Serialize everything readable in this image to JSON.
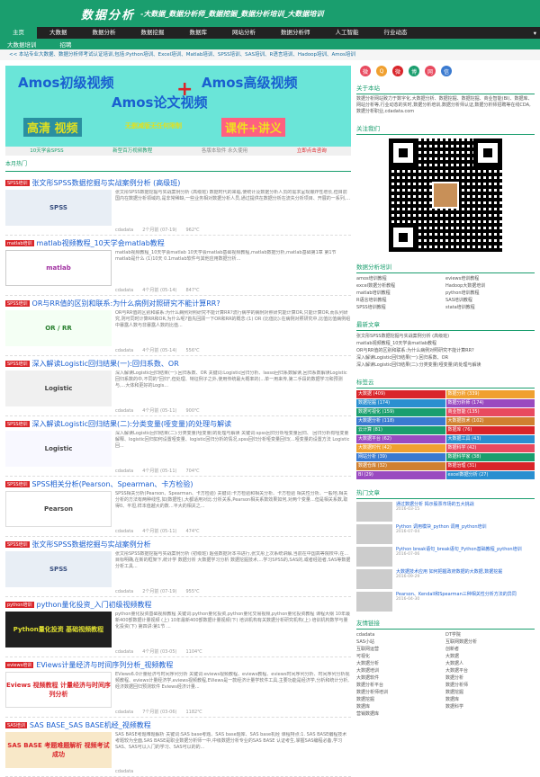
{
  "header": {
    "logo": "数据分析",
    "slogan": "-大数据_数据分析师_数据挖掘_数据分析培训_大数据培训"
  },
  "nav": {
    "items": [
      "主页",
      "大数据",
      "数据分析",
      "数据挖掘",
      "数据库",
      "网站分析",
      "数据分析师",
      "人工智能",
      "行业动态"
    ]
  },
  "subnav": {
    "items": [
      "大数据培训",
      "招聘"
    ]
  },
  "ticker": "<< 本站专业大数据、数据分析师考试认证培训,包括:Python培训、Excel培训、Matlab培训、SPSS培训、SAS培训、R语言培训、Hadoop培训、Amos培训",
  "banner": {
    "t1": "Amos初级视频",
    "t2": "Amos高级视频",
    "plus": "+",
    "t3": "Amos论文视频",
    "t4": "高清 视频",
    "t5": "无删减版无任何限制",
    "t6": "课件+讲义",
    "links": [
      "10天学会SPSS",
      "新型百万视频教程",
      "各版本软件 永久使用",
      "立即点击咨询"
    ]
  },
  "hot_label": "本月热门",
  "articles": [
    {
      "tag": "SPSS培训",
      "title": "张文彤SPSS数据挖掘与实战案例分析 (高级班)",
      "thumb": "SPSS",
      "excerpt": "张文彤SPSS数据挖掘与实战案例分析 (高级班) 数据时代的来临,使统计及数据分析人员的需求呈现爆炸性增长,但目前国内在数据分析领域的,是非常稀缺,一些业务相对数据分析人员,通过提供在数据分析在流失分析项目、开展的一系列,...",
      "meta": [
        "cdadata",
        "2个月前 (07-19)",
        "962℃"
      ],
      "thumb_class": "th-spss"
    },
    {
      "tag": "matlab培训",
      "title": "matlab视频教程_10天学会matlab教程",
      "thumb": "matlab",
      "excerpt": "matlab视频教程_10天学会matlab 10天学会matlab基础视频教程,matlab数据分析,matlab基础第1章 第1节matlab是什么 (1)10天 0.1matlab软件与其他应用数据分析...",
      "meta": [
        "cdadata",
        "4个月前 (05-14)",
        "847℃"
      ],
      "thumb_class": "th-matlab"
    },
    {
      "tag": "SPSS培训",
      "title": "OR与RR值的区别和联系:为什么病例对照研究不能计算RR?",
      "thumb": "OR / RR",
      "excerpt": "OR与RR值的区别和联系:为什么病例对照研究不能计算RR?流行病学的病例对照研究能计算OR,只能计算OR,而队列研究,则可同时计算RR和OR,为什么呢?首先回顾一下OR和RR的概念:(1) OR (比值比):在病例对照研究中,比值比值病例组中暴露人数与非暴露人数的比值...",
      "meta": [
        "cdadata",
        "4个月前 (05-14)",
        "556℃"
      ],
      "thumb_class": "th-or"
    },
    {
      "tag": "SPSS培训",
      "title": "深入解读Logistic回归结果(一):回归系数、OR",
      "thumb": "Logistic",
      "excerpt": "深入解读Logistic回归结果(一):回归系数、OR 关键词:Logistic回归分析、lasso回归系数解读,回归系数解读Logistic回归系数的中,不同的\"回归\",但处理、特征例子之外,使用传统最大概率的(...单一用来传,第二手段的数据学习和预测与,...大体和更好的Logis...",
      "meta": [
        "cdadata",
        "4个月前 (05-11)",
        "900℃"
      ],
      "thumb_class": "th-logit"
    },
    {
      "tag": "SPSS培训",
      "title": "深入解读Logistic回归结果(二):分类变量(哑变量)的处理与解读",
      "thumb": "Logistic",
      "excerpt": "深入解读Logistic回归结果(二):分类变量(哑变量)的处理与解读 关键词:spss回归分析哑变量回归、 回归分析有哑变量解释、logistic回归如何设置哑变量、logistic回归分析的情况,spss回归分析哑变量回归(...哑变量的设置方法 Logistic回...",
      "meta": [
        "cdadata",
        "4个月前 (05-11)",
        "704℃"
      ],
      "thumb_class": "th-logit2"
    },
    {
      "tag": "SPSS培训",
      "title": "SPSS相关分析(Pearson、Spearman、卡方检验)",
      "thumb": "Pearson",
      "excerpt": "SPSS相关分析(Pearson、Spearman、卡方检验) 关键词:卡方检验和相关分析、卡方检验 相关性分析、一般地,相关分析的方法有两种线性,如(数据性),大都适用对比:分析关系,Pearson相关系数效果如何,对两个变量…但是相关系数,取得0、平坦,样本值越大的数…平大的相关之...",
      "meta": [
        "cdadata",
        "4个月前 (05-11)",
        "474℃"
      ],
      "thumb_class": "th-pearson"
    },
    {
      "tag": "SPSS培训",
      "title": "张文彤SPSS数据挖掘与实战案例分析",
      "thumb": "SPSS",
      "excerpt": "张文彤SPSS数据挖掘与实战案例分析 (初级班) 超强数据对本书进行,张文彤上次系统讲解,当前在中国高等院校中,在...目标明确,在新的框架下,统计学 数据分析 大数据学习分析 数据挖掘技术,...学习SPSS的,SAS的,或者经验者,SAS等数据分析工具...",
      "meta": [
        "cdadata",
        "2个月前 (07-19)",
        "955℃"
      ],
      "thumb_class": "th-spss2"
    },
    {
      "tag": "python培训",
      "title": "python量化投资_入门初级视频教程",
      "thumb": "Python量化投资 基础视频教程",
      "excerpt": "python量化投资基础视频教程 关键词:python量化投资,python量化交易视频,python量化投资教程 课程大纲 10年最新400部数据计量视频 (上) 10年最新400部数据计量视频(下) 培训机构有关数据分析研究机构(上) 培训机构数学与量化投资(下) 第四讲:第1节 ...",
      "meta": [
        "cdadata",
        "4个月前 (03-05)",
        "1104℃"
      ],
      "thumb_class": "th-python"
    },
    {
      "tag": "eviews培训",
      "title": "EViews计量经济与时间序列分析_视频教程",
      "thumb": "Eviews 视频教程 计量经济与时间序列分析",
      "excerpt": "EViews6.0计量经济与时间序列分析 关键词:eviews视频教程、eviews教程、eviews时间序列分析、时间序列分析视频教程、eviews计量经济学,eviews视频教程,EViews是一款经济计量学软件工具,主要功能是经济学,分析和统计分析,经济数据回归预测软件 Eviews经济计量...",
      "meta": [
        "cdadata",
        "7个月前 (03-06)",
        "1182℃"
      ],
      "thumb_class": "th-eviews"
    },
    {
      "tag": "SAS培训",
      "title": "SAS BASE_SAS BASE机经_视频教程",
      "thumb": "SAS BASE 考题难题解析 视频考试成功",
      "excerpt": "SAS BASE考题难题解析 关键词:SAS base考题、SAS base题库、SAS base机经 课程特点:1. SAS BASE编程技术考题较为全面,SAS BASE是职业数据分析师一中,中级数据分析专业的SAS BASE 认证考生,掌握SAS编程必备,学习SAS、SAS可以入门的学习、SAS可以的的...",
      "meta": [
        "cdadata",
        "",
        ""
      ],
      "thumb_class": "th-sas"
    }
  ],
  "social": {
    "colors": [
      "#e84a5f",
      "#f0a030",
      "#d9252a",
      "#1a9e6e",
      "#e84a5f",
      "#3a7ad0"
    ],
    "glyphs": [
      "微",
      "Q",
      "微",
      "博",
      "网",
      "信"
    ]
  },
  "sidebar": {
    "about_title": "关于本站",
    "about_text": "数据分析网站致力于数字化,大数据分析、数据挖掘、数据挖掘、商业智能(BI)、数据库、网站分析等,行业动态的实时,数据分析培训,数据分析师认证,数据分析师招聘等在线CDA,数据分析职业,cdadata.com",
    "follow_title": "关注我们",
    "training_title": "数据分析培训",
    "training": [
      "amos培训教程",
      "eviews培训教程",
      "excel数据分析教程",
      "Hadoop大数据培训",
      "matlab培训教程",
      "python培训教程",
      "R语言培训教程",
      "SAS培训教程",
      "SPSS培训教程",
      "stata培训教程"
    ],
    "latest_title": "最新文章",
    "latest": [
      "张文彤SPSS数据挖掘与实战案例分析 (高级班)",
      "matlab视频教程_10天学会matlab教程",
      "OR与RR值的区别和联系:为什么病例对照研究不能计算RR?",
      "深入解读Logistic回归结果(一):回归系数、OR",
      "深入解读Logistic回归结果(二):分类变量(哑变量)的处理与解读"
    ],
    "tags_title": "标签云",
    "tags": [
      {
        "label": "大数据 (409)",
        "color": "#d9252a"
      },
      {
        "label": "数据分析 (339)",
        "color": "#f0a030"
      },
      {
        "label": "数据挖掘 (174)",
        "color": "#2a8fd0"
      },
      {
        "label": "数据分析师 (174)",
        "color": "#9a4ac0"
      },
      {
        "label": "数据可视化 (159)",
        "color": "#1a9e6e"
      },
      {
        "label": "商业智能 (135)",
        "color": "#e84a5f"
      },
      {
        "label": "大数据分析 (118)",
        "color": "#3a7ad0"
      },
      {
        "label": "大数据技术 (102)",
        "color": "#d08030"
      },
      {
        "label": "云计算 (81)",
        "color": "#1a9e6e"
      },
      {
        "label": "数据库 (76)",
        "color": "#d9252a"
      },
      {
        "label": "大数据平台 (62)",
        "color": "#9a4ac0"
      },
      {
        "label": "大数据工具 (43)",
        "color": "#2a8fd0"
      },
      {
        "label": "大数据时代 (42)",
        "color": "#f0a030"
      },
      {
        "label": "数据科学 (42)",
        "color": "#e84a5f"
      },
      {
        "label": "网站分析 (39)",
        "color": "#3a7ad0"
      },
      {
        "label": "数据科学家 (38)",
        "color": "#1a9e6e"
      },
      {
        "label": "数据仓库 (32)",
        "color": "#d08030"
      },
      {
        "label": "数据治理 (31)",
        "color": "#d9252a"
      },
      {
        "label": "BI (29)",
        "color": "#9a4ac0"
      },
      {
        "label": "excel数据分析 (27)",
        "color": "#2a8fd0"
      }
    ],
    "hot_title": "热门文章",
    "hot": [
      {
        "title": "通过数据分析 揭示股票市场的五大挑战",
        "date": "2016-03-15"
      },
      {
        "title": "Python 调用模块_python 调用_python培训",
        "date": "2016-07-04"
      },
      {
        "title": "Python break语句_break语句_Python基础教程_python培训",
        "date": "2016-07-06"
      },
      {
        "title": "大数据技术应用 如何把握政府数据的大数据,数据挖掘",
        "date": "2016-09-29"
      },
      {
        "title": "Pearson、Kendall和Spearman三种相关性分析方法的异同",
        "date": "2016-04-30"
      }
    ],
    "links_title": "友情链接",
    "links": [
      "cdadata",
      "DT学院",
      "SAS小站",
      "互联网数据分析",
      "互联网运营",
      "创新者",
      "可视化",
      "大数据",
      "大数据分析",
      "大数据人",
      "大数据培训",
      "大数据平台",
      "大数据软件",
      "数据分析",
      "数据分析平台",
      "数据分析师",
      "数据分析师培训",
      "数据挖掘",
      "数据挖掘",
      "数据库",
      "数据库",
      "数据科学",
      "营销数据库"
    ]
  }
}
